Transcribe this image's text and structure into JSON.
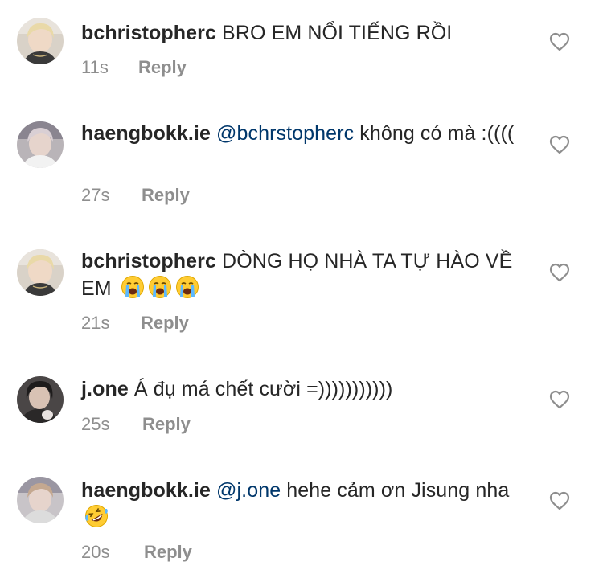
{
  "comments": [
    {
      "username": "bchristopherc",
      "mention": "",
      "text": "BRO EM NỔI TIẾNG RỒI",
      "time": "11s",
      "reply_label": "Reply",
      "avatar": "avatar-blond-hair"
    },
    {
      "username": "haengbokk.ie",
      "mention": "@bchrstopherc",
      "text": "không có mà :((((",
      "time": "27s",
      "reply_label": "Reply",
      "avatar": "avatar-light-hair"
    },
    {
      "username": "bchristopherc",
      "mention": "",
      "text": "DÒNG HỌ NHÀ TA TỰ HÀO VỀ EM",
      "emojis": [
        "loudly-crying-face",
        "loudly-crying-face",
        "loudly-crying-face"
      ],
      "time": "21s",
      "reply_label": "Reply",
      "avatar": "avatar-blond-hair"
    },
    {
      "username": "j.one",
      "mention": "",
      "text": "Á đụ má chết cười =)))))))))))",
      "time": "25s",
      "reply_label": "Reply",
      "avatar": "avatar-dark-hair"
    },
    {
      "username": "haengbokk.ie",
      "mention": "@j.one",
      "text": "hehe cảm ơn Jisung nha",
      "emojis": [
        "rolling-on-floor-laughing"
      ],
      "time": "20s",
      "reply_label": "Reply",
      "avatar": "avatar-light-hair"
    }
  ]
}
